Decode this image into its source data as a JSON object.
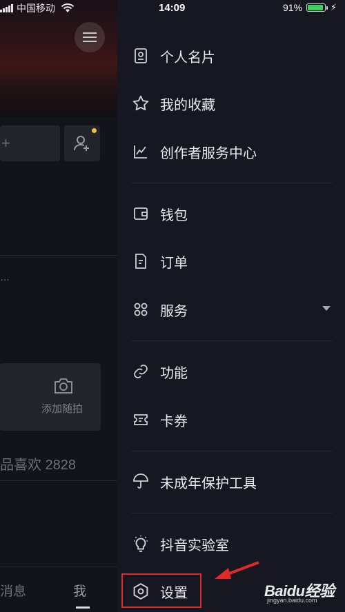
{
  "status": {
    "carrier": "中国移动",
    "time": "14:09",
    "battery": "91%",
    "battery_level": 0.91,
    "battery_color": "#3bd15a"
  },
  "background": {
    "tabs": {
      "messages": "消息",
      "me": "我"
    },
    "camera_label": "添加随拍",
    "likes": "品喜欢 2828",
    "dots": "…"
  },
  "menu": {
    "items": [
      {
        "label": "个人名片",
        "icon": "id-card-icon"
      },
      {
        "label": "我的收藏",
        "icon": "star-icon"
      },
      {
        "label": "创作者服务中心",
        "icon": "line-chart-icon"
      },
      {
        "label": "钱包",
        "icon": "wallet-icon"
      },
      {
        "label": "订单",
        "icon": "order-document-icon"
      },
      {
        "label": "服务",
        "icon": "services-grid-icon"
      },
      {
        "label": "功能",
        "icon": "link-icon"
      },
      {
        "label": "卡券",
        "icon": "ticket-icon"
      },
      {
        "label": "未成年保护工具",
        "icon": "umbrella-icon"
      },
      {
        "label": "抖音实验室",
        "icon": "lightbulb-icon"
      },
      {
        "label": "设置",
        "icon": "settings-gear-icon"
      }
    ]
  },
  "annotation": {
    "highlight_color": "#e02a2a"
  },
  "watermark": {
    "brand": "Baidu经验",
    "url": "jingyan.baidu.com"
  }
}
